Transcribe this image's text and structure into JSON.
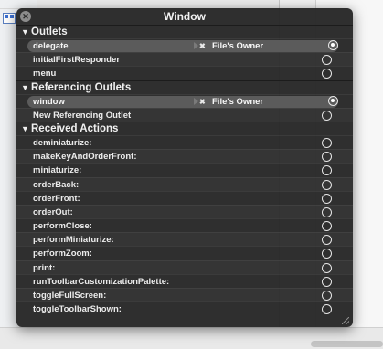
{
  "popover": {
    "title": "Window",
    "sections": {
      "outlets": {
        "label": "Outlets",
        "rows": [
          {
            "name": "delegate",
            "connected": true,
            "target": "File's Owner"
          },
          {
            "name": "initialFirstResponder",
            "connected": false
          },
          {
            "name": "menu",
            "connected": false
          }
        ]
      },
      "referencing": {
        "label": "Referencing Outlets",
        "rows": [
          {
            "name": "window",
            "connected": true,
            "target": "File's Owner"
          },
          {
            "name": "New Referencing Outlet",
            "connected": false
          }
        ]
      },
      "actions": {
        "label": "Received Actions",
        "rows": [
          {
            "name": "deminiaturize:"
          },
          {
            "name": "makeKeyAndOrderFront:"
          },
          {
            "name": "miniaturize:"
          },
          {
            "name": "orderBack:"
          },
          {
            "name": "orderFront:"
          },
          {
            "name": "orderOut:"
          },
          {
            "name": "performClose:"
          },
          {
            "name": "performMiniaturize:"
          },
          {
            "name": "performZoom:"
          },
          {
            "name": "print:"
          },
          {
            "name": "runToolbarCustomizationPalette:"
          },
          {
            "name": "toggleFullScreen:"
          },
          {
            "name": "toggleToolbarShown:"
          }
        ]
      }
    },
    "icons": {
      "close": "close-icon",
      "disclosure": "disclosure-triangle-icon",
      "disconnect": "disconnect-x-icon",
      "connection_circle": "connection-circle-icon",
      "resize": "resize-grip-icon"
    }
  },
  "colors": {
    "hud_background": "#262626",
    "pill": "#5b5b5b",
    "text": "#ececec"
  }
}
